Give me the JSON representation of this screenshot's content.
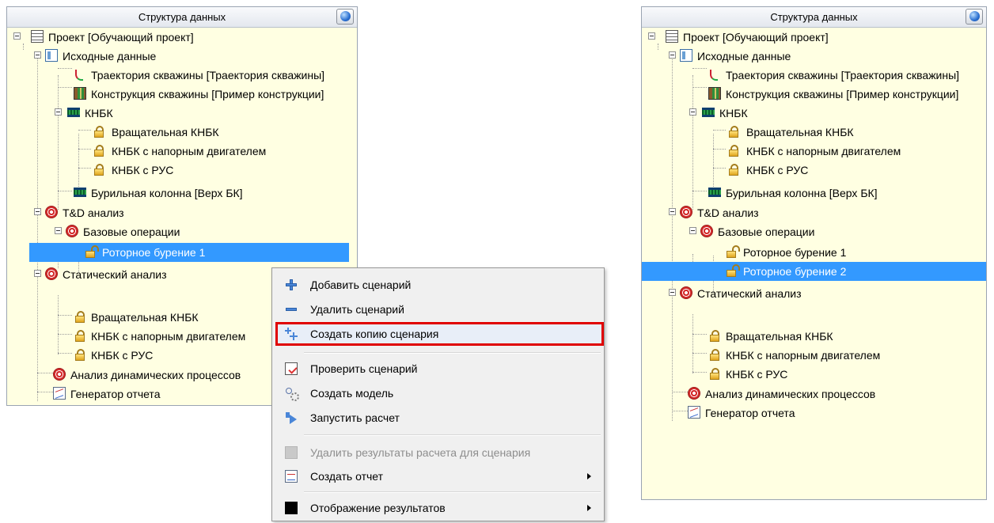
{
  "left_panel": {
    "title": "Структура данных",
    "tree": [
      {
        "label": "Проект [Обучающий проект]",
        "icon": "project-icon"
      },
      {
        "label": "Исходные данные",
        "icon": "source-data-icon"
      },
      {
        "label": "Траектория скважины [Траектория скважины]",
        "icon": "trajectory-icon"
      },
      {
        "label": "Конструкция скважины [Пример конструкции]",
        "icon": "construction-icon"
      },
      {
        "label": "КНБК",
        "icon": "bha-icon"
      },
      {
        "label": "Вращательная КНБК",
        "icon": "lock-icon"
      },
      {
        "label": "КНБК с напорным двигателем",
        "icon": "lock-icon"
      },
      {
        "label": "КНБК с РУС",
        "icon": "lock-icon"
      },
      {
        "label": "Бурильная колонна [Верх БК]",
        "icon": "drill-string-icon"
      },
      {
        "label": "T&D анализ",
        "icon": "target-icon"
      },
      {
        "label": "Базовые операции",
        "icon": "target-icon"
      },
      {
        "label": "Роторное бурение 1",
        "icon": "unlock-icon"
      },
      {
        "label": "Статический анализ",
        "icon": "target-icon"
      },
      {
        "label": "Вращательная КНБК",
        "icon": "lock-icon"
      },
      {
        "label": "КНБК с напорным двигателем",
        "icon": "lock-icon"
      },
      {
        "label": "КНБК с РУС",
        "icon": "lock-icon"
      },
      {
        "label": "Анализ динамических процессов",
        "icon": "target-icon"
      },
      {
        "label": "Генератор отчета",
        "icon": "report-icon"
      }
    ]
  },
  "context_menu": {
    "items": [
      {
        "label": "Добавить сценарий",
        "icon": "add-icon"
      },
      {
        "label": "Удалить сценарий",
        "icon": "remove-icon"
      },
      {
        "label": "Создать копию сценария",
        "icon": "copy-icon",
        "highlighted": true
      },
      {
        "label": "Проверить сценарий",
        "icon": "check-icon"
      },
      {
        "label": "Создать модель",
        "icon": "model-icon"
      },
      {
        "label": "Запустить расчет",
        "icon": "run-icon"
      },
      {
        "label": "Удалить результаты расчета для сценария",
        "icon": "delete-results-icon",
        "disabled": true
      },
      {
        "label": "Создать отчет",
        "icon": "report-icon",
        "submenu": true
      },
      {
        "label": "Отображение результатов",
        "icon": "results-icon",
        "submenu": true
      }
    ]
  },
  "right_panel": {
    "title": "Структура данных",
    "tree": [
      {
        "label": "Проект [Обучающий проект]",
        "icon": "project-icon"
      },
      {
        "label": "Исходные данные",
        "icon": "source-data-icon"
      },
      {
        "label": "Траектория скважины [Траектория скважины]",
        "icon": "trajectory-icon"
      },
      {
        "label": "Конструкция скважины [Пример конструкции]",
        "icon": "construction-icon"
      },
      {
        "label": "КНБК",
        "icon": "bha-icon"
      },
      {
        "label": "Вращательная КНБК",
        "icon": "lock-icon"
      },
      {
        "label": "КНБК с напорным двигателем",
        "icon": "lock-icon"
      },
      {
        "label": "КНБК с РУС",
        "icon": "lock-icon"
      },
      {
        "label": "Бурильная колонна [Верх БК]",
        "icon": "drill-string-icon"
      },
      {
        "label": "T&D анализ",
        "icon": "target-icon"
      },
      {
        "label": "Базовые операции",
        "icon": "target-icon"
      },
      {
        "label": "Роторное бурение 1",
        "icon": "unlock-icon"
      },
      {
        "label": "Роторное бурение 2",
        "icon": "unlock-icon",
        "selected": true
      },
      {
        "label": "Статический анализ",
        "icon": "target-icon"
      },
      {
        "label": "Вращательная КНБК",
        "icon": "lock-icon"
      },
      {
        "label": "КНБК с напорным двигателем",
        "icon": "lock-icon"
      },
      {
        "label": "КНБК с РУС",
        "icon": "lock-icon"
      },
      {
        "label": "Анализ динамических процессов",
        "icon": "target-icon"
      },
      {
        "label": "Генератор отчета",
        "icon": "report-icon"
      }
    ]
  }
}
